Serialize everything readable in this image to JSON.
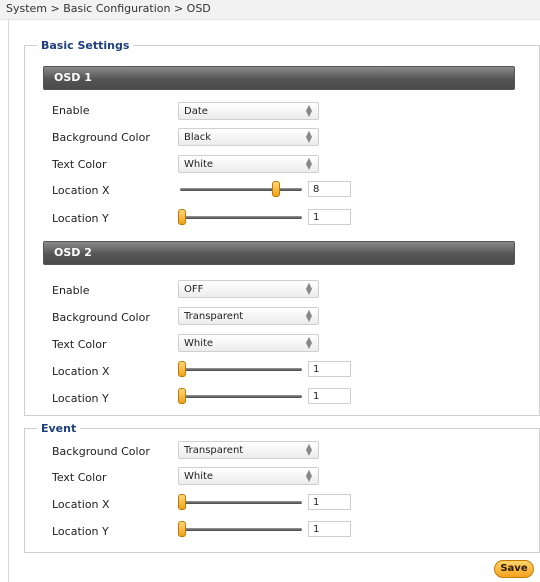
{
  "breadcrumb": "System > Basic Configuration > OSD",
  "basic_settings": {
    "legend": "Basic Settings",
    "osd1": {
      "title": "OSD 1",
      "enable_label": "Enable",
      "enable_value": "Date",
      "bg_label": "Background Color",
      "bg_value": "Black",
      "text_label": "Text Color",
      "text_value": "White",
      "locx_label": "Location X",
      "locx_value": "8",
      "locy_label": "Location Y",
      "locy_value": "1"
    },
    "osd2": {
      "title": "OSD 2",
      "enable_label": "Enable",
      "enable_value": "OFF",
      "bg_label": "Background Color",
      "bg_value": "Transparent",
      "text_label": "Text Color",
      "text_value": "White",
      "locx_label": "Location X",
      "locx_value": "1",
      "locy_label": "Location Y",
      "locy_value": "1"
    }
  },
  "event": {
    "legend": "Event",
    "bg_label": "Background Color",
    "bg_value": "Transparent",
    "text_label": "Text Color",
    "text_value": "White",
    "locx_label": "Location X",
    "locx_value": "1",
    "locy_label": "Location Y",
    "locy_value": "1"
  },
  "save_label": "Save",
  "colors": {
    "accent": "#f4a21d",
    "header_dark": "#555555",
    "legend_blue": "#1d3f7a"
  }
}
